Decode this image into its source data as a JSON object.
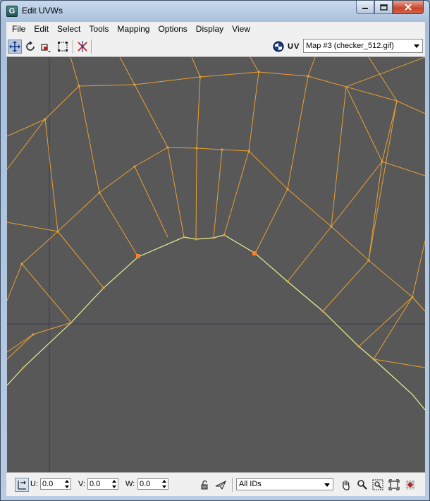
{
  "window": {
    "title": "Edit UVWs",
    "app_icon_glyph": "G"
  },
  "menubar": {
    "items": [
      "File",
      "Edit",
      "Select",
      "Tools",
      "Mapping",
      "Options",
      "Display",
      "View"
    ]
  },
  "toolbar": {
    "uv_label": "UV",
    "map_select_value": "Map #3 (checker_512.gif)"
  },
  "statusbar": {
    "u_label": "U:",
    "u_value": "0.0",
    "v_label": "V:",
    "v_value": "0.0",
    "w_label": "W:",
    "w_value": "0.0",
    "id_select_value": "All IDs"
  },
  "viewport": {
    "background_color": "#585858",
    "edge_color": "#e8a030",
    "selected_edge_color": "#e4f090",
    "vertex_color": "#ff8020",
    "grid_axis_color": "#3a3a5a"
  }
}
